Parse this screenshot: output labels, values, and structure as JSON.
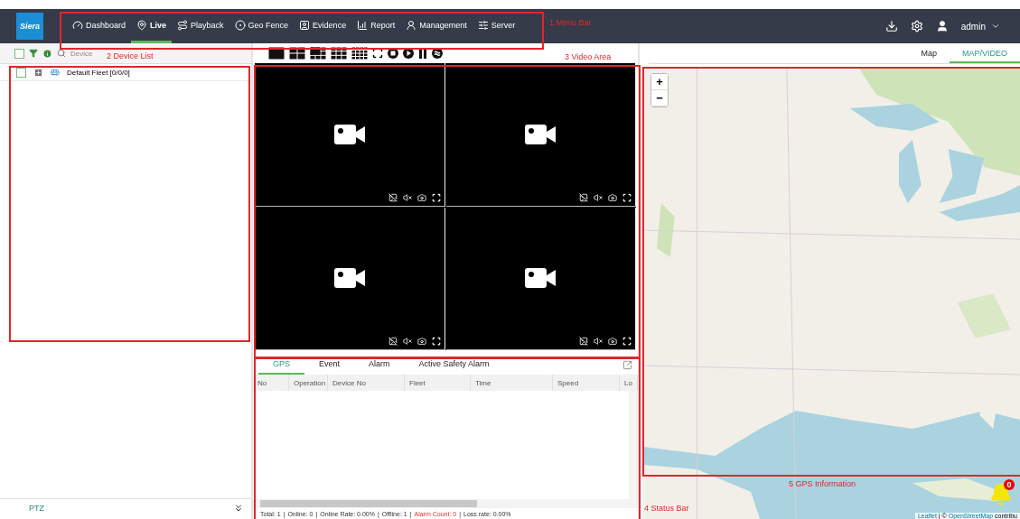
{
  "header": {
    "logo": "Siera",
    "nav": [
      {
        "label": "Dashboard",
        "selected": false
      },
      {
        "label": "Live",
        "selected": true
      },
      {
        "label": "Playback",
        "selected": false
      },
      {
        "label": "Geo Fence",
        "selected": false
      },
      {
        "label": "Evidence",
        "selected": false
      },
      {
        "label": "Report",
        "selected": false
      },
      {
        "label": "Management",
        "selected": false
      },
      {
        "label": "Server",
        "selected": false
      }
    ],
    "user": "admin"
  },
  "device_panel": {
    "select_all_checked": false,
    "search_label": "Device",
    "tree": [
      {
        "label": "Default Fleet",
        "count": "[0/0/0]",
        "checked": false
      }
    ],
    "ptz": "PTZ"
  },
  "info_panel": {
    "tabs": [
      {
        "label": "GPS",
        "selected": true
      },
      {
        "label": "Event",
        "selected": false
      },
      {
        "label": "Alarm",
        "selected": false
      },
      {
        "label": "Active Safety Alarm",
        "selected": false
      }
    ],
    "columns": [
      "No",
      "Operation",
      "Device No",
      "Fleet",
      "Time",
      "Speed",
      "Lo"
    ]
  },
  "status_bar": {
    "separator": "|",
    "items": [
      {
        "text": "Total: 1",
        "kind": "normal"
      },
      {
        "text": "Online: 0",
        "kind": "normal"
      },
      {
        "text": "Online Rate: 0.00%",
        "kind": "normal"
      },
      {
        "text": "Offline: 1",
        "kind": "normal"
      },
      {
        "text": "Alarm Count: 0",
        "kind": "alert"
      },
      {
        "text": "Loss rate: 0.00%",
        "kind": "normal"
      }
    ]
  },
  "map_panel": {
    "tabs": [
      {
        "label": "Map",
        "selected": false
      },
      {
        "label": "MAP/VIDEO",
        "selected": true
      }
    ],
    "zoom_in": "+",
    "zoom_out": "−",
    "alarm_count": "0",
    "attribution_links": [
      "Leaflet",
      "OpenStreetMap"
    ],
    "attribution_sep": " | © ",
    "attribution_tail": " contribu"
  },
  "annotations": [
    {
      "label": "1 Menu Bar"
    },
    {
      "label": "2 Device List"
    },
    {
      "label": "3 Video Area"
    },
    {
      "label": "4 Status Bar"
    },
    {
      "label": "5 GPS Information"
    }
  ]
}
